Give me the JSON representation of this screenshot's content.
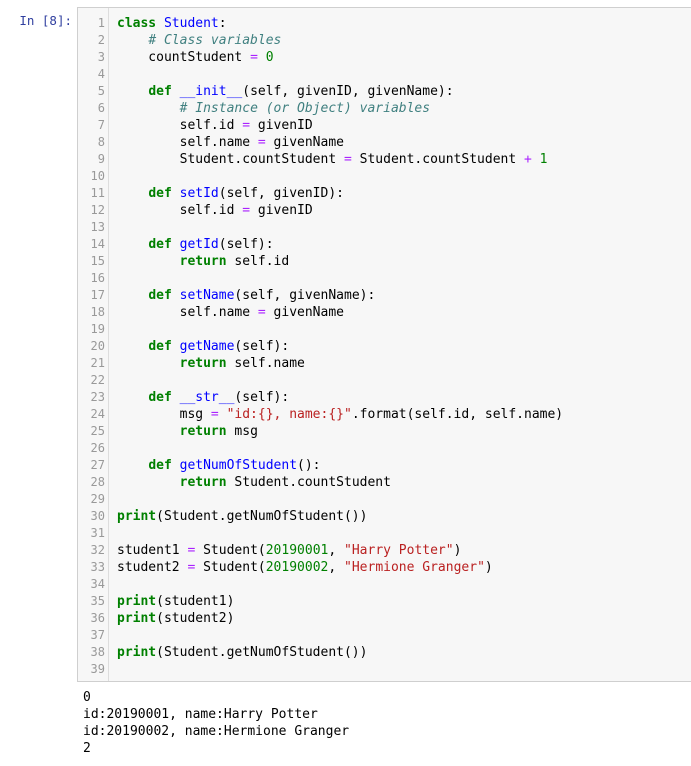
{
  "prompt": "In [8]:",
  "code_lines": [
    [
      {
        "t": "class",
        "c": "kw"
      },
      {
        "t": " "
      },
      {
        "t": "Student",
        "c": "fn"
      },
      {
        "t": ":"
      }
    ],
    [
      {
        "t": "    "
      },
      {
        "t": "# Class variables",
        "c": "cm"
      }
    ],
    [
      {
        "t": "    countStudent "
      },
      {
        "t": "=",
        "c": "op"
      },
      {
        "t": " "
      },
      {
        "t": "0",
        "c": "num"
      }
    ],
    [],
    [
      {
        "t": "    "
      },
      {
        "t": "def",
        "c": "kw"
      },
      {
        "t": " "
      },
      {
        "t": "__init__",
        "c": "fn"
      },
      {
        "t": "(self, givenID, givenName):"
      }
    ],
    [
      {
        "t": "        "
      },
      {
        "t": "# Instance (or Object) variables",
        "c": "cm"
      }
    ],
    [
      {
        "t": "        self.id "
      },
      {
        "t": "=",
        "c": "op"
      },
      {
        "t": " givenID"
      }
    ],
    [
      {
        "t": "        self.name "
      },
      {
        "t": "=",
        "c": "op"
      },
      {
        "t": " givenName"
      }
    ],
    [
      {
        "t": "        Student.countStudent "
      },
      {
        "t": "=",
        "c": "op"
      },
      {
        "t": " Student.countStudent "
      },
      {
        "t": "+",
        "c": "op"
      },
      {
        "t": " "
      },
      {
        "t": "1",
        "c": "num"
      }
    ],
    [],
    [
      {
        "t": "    "
      },
      {
        "t": "def",
        "c": "kw"
      },
      {
        "t": " "
      },
      {
        "t": "setId",
        "c": "fn"
      },
      {
        "t": "(self, givenID):"
      }
    ],
    [
      {
        "t": "        self.id "
      },
      {
        "t": "=",
        "c": "op"
      },
      {
        "t": " givenID"
      }
    ],
    [],
    [
      {
        "t": "    "
      },
      {
        "t": "def",
        "c": "kw"
      },
      {
        "t": " "
      },
      {
        "t": "getId",
        "c": "fn"
      },
      {
        "t": "(self):"
      }
    ],
    [
      {
        "t": "        "
      },
      {
        "t": "return",
        "c": "kw"
      },
      {
        "t": " self.id"
      }
    ],
    [],
    [
      {
        "t": "    "
      },
      {
        "t": "def",
        "c": "kw"
      },
      {
        "t": " "
      },
      {
        "t": "setName",
        "c": "fn"
      },
      {
        "t": "(self, givenName):"
      }
    ],
    [
      {
        "t": "        self.name "
      },
      {
        "t": "=",
        "c": "op"
      },
      {
        "t": " givenName"
      }
    ],
    [],
    [
      {
        "t": "    "
      },
      {
        "t": "def",
        "c": "kw"
      },
      {
        "t": " "
      },
      {
        "t": "getName",
        "c": "fn"
      },
      {
        "t": "(self):"
      }
    ],
    [
      {
        "t": "        "
      },
      {
        "t": "return",
        "c": "kw"
      },
      {
        "t": " self.name"
      }
    ],
    [],
    [
      {
        "t": "    "
      },
      {
        "t": "def",
        "c": "kw"
      },
      {
        "t": " "
      },
      {
        "t": "__str__",
        "c": "fn"
      },
      {
        "t": "(self):"
      }
    ],
    [
      {
        "t": "        msg "
      },
      {
        "t": "=",
        "c": "op"
      },
      {
        "t": " "
      },
      {
        "t": "\"id:{}, name:{}\"",
        "c": "str"
      },
      {
        "t": ".format(self.id, self.name)"
      }
    ],
    [
      {
        "t": "        "
      },
      {
        "t": "return",
        "c": "kw"
      },
      {
        "t": " msg"
      }
    ],
    [],
    [
      {
        "t": "    "
      },
      {
        "t": "def",
        "c": "kw"
      },
      {
        "t": " "
      },
      {
        "t": "getNumOfStudent",
        "c": "fn"
      },
      {
        "t": "():"
      }
    ],
    [
      {
        "t": "        "
      },
      {
        "t": "return",
        "c": "kw"
      },
      {
        "t": " Student.countStudent"
      }
    ],
    [],
    [
      {
        "t": "print",
        "c": "kw"
      },
      {
        "t": "(Student.getNumOfStudent())"
      }
    ],
    [],
    [
      {
        "t": "student1 "
      },
      {
        "t": "=",
        "c": "op"
      },
      {
        "t": " Student("
      },
      {
        "t": "20190001",
        "c": "num"
      },
      {
        "t": ", "
      },
      {
        "t": "\"Harry Potter\"",
        "c": "str"
      },
      {
        "t": ")"
      }
    ],
    [
      {
        "t": "student2 "
      },
      {
        "t": "=",
        "c": "op"
      },
      {
        "t": " Student("
      },
      {
        "t": "20190002",
        "c": "num"
      },
      {
        "t": ", "
      },
      {
        "t": "\"Hermione Granger\"",
        "c": "str"
      },
      {
        "t": ")"
      }
    ],
    [],
    [
      {
        "t": "print",
        "c": "kw"
      },
      {
        "t": "(student1)"
      }
    ],
    [
      {
        "t": "print",
        "c": "kw"
      },
      {
        "t": "(student2)"
      }
    ],
    [],
    [
      {
        "t": "print",
        "c": "kw"
      },
      {
        "t": "(Student.getNumOfStudent())"
      }
    ],
    []
  ],
  "output_lines": [
    "0",
    "id:20190001, name:Harry Potter",
    "id:20190002, name:Hermione Granger",
    "2"
  ]
}
